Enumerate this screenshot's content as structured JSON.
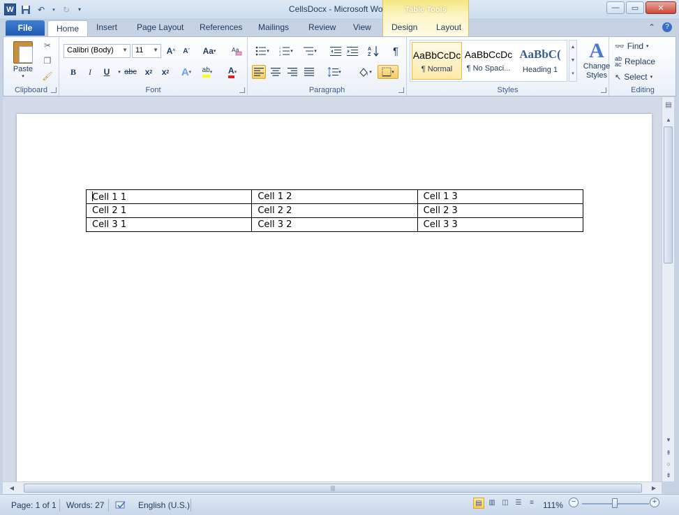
{
  "window": {
    "title": "CellsDocx - Microsoft Word",
    "context_tab_group": "Table Tools"
  },
  "tabs": {
    "file": "File",
    "items": [
      "Home",
      "Insert",
      "Page Layout",
      "References",
      "Mailings",
      "Review",
      "View",
      "Design",
      "Layout"
    ],
    "active": "Home"
  },
  "ribbon": {
    "clipboard": {
      "paste_label": "Paste",
      "group_label": "Clipboard"
    },
    "font": {
      "font_name": "Calibri (Body)",
      "font_size": "11",
      "group_label": "Font"
    },
    "paragraph": {
      "group_label": "Paragraph"
    },
    "styles": {
      "group_label": "Styles",
      "items": [
        {
          "sample": "AaBbCcDc",
          "name": "¶ Normal"
        },
        {
          "sample": "AaBbCcDc",
          "name": "¶ No Spaci..."
        },
        {
          "sample": "AaBbC(",
          "name": "Heading 1"
        }
      ],
      "change_styles": "Change Styles"
    },
    "editing": {
      "group_label": "Editing",
      "find": "Find",
      "replace": "Replace",
      "select": "Select"
    }
  },
  "document": {
    "table": [
      [
        "Cell 1 1",
        "Cell 1 2",
        "Cell 1 3"
      ],
      [
        "Cell 2 1",
        "Cell 2 2",
        "Cell 2 3"
      ],
      [
        "Cell 3 1",
        "Cell 3 2",
        "Cell 3 3"
      ]
    ]
  },
  "statusbar": {
    "page": "Page: 1 of 1",
    "words": "Words: 27",
    "language": "English (U.S.)",
    "zoom": "111%"
  },
  "colors": {
    "file_tab": "#2b5fb5",
    "table_tools": "#f5e67f",
    "selected_button": "#f8cd5e"
  }
}
